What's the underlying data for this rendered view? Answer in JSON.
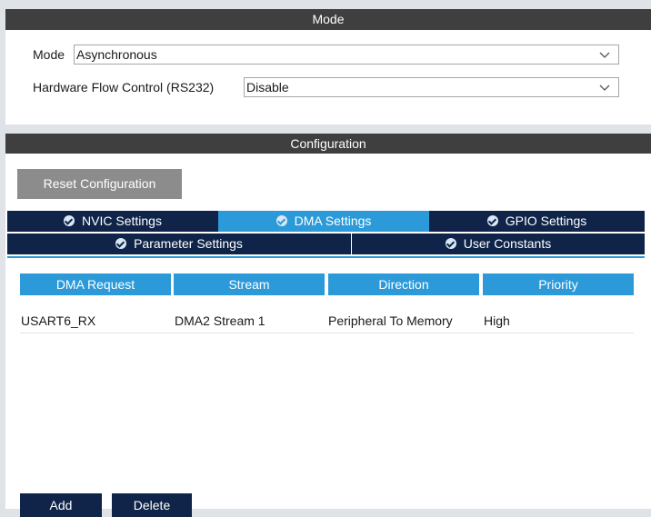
{
  "mode_section": {
    "header": "Mode",
    "mode_label": "Mode",
    "mode_value": "Asynchronous",
    "flow_label": "Hardware Flow Control (RS232)",
    "flow_value": "Disable"
  },
  "config_section": {
    "header": "Configuration",
    "reset_button": "Reset Configuration",
    "tabs_row1": [
      "NVIC Settings",
      "DMA Settings",
      "GPIO Settings"
    ],
    "tabs_row2": [
      "Parameter Settings",
      "User Constants"
    ],
    "active_tab": "DMA Settings"
  },
  "dma_table": {
    "columns": [
      "DMA Request",
      "Stream",
      "Direction",
      "Priority"
    ],
    "rows": [
      [
        "USART6_RX",
        "DMA2 Stream 1",
        "Peripheral To Memory",
        "High"
      ]
    ]
  },
  "actions": {
    "add": "Add",
    "delete": "Delete"
  },
  "colors": {
    "section_bar": "#3f3f3f",
    "tab_dark": "#0f2448",
    "tab_active": "#2c9ad8",
    "button_grey": "#8c8c8c"
  }
}
